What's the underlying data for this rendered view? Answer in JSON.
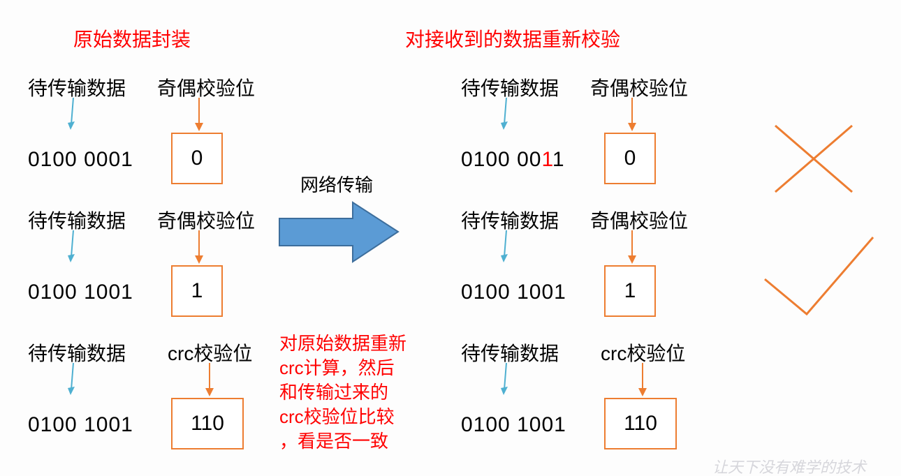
{
  "titles": {
    "left": "原始数据封装",
    "right": "对接收到的数据重新校验"
  },
  "labels": {
    "data_label": "待传输数据",
    "parity_label": "奇偶校验位",
    "crc_label": "crc校验位",
    "transfer": "网络传输"
  },
  "sender": {
    "row1": {
      "data": "0100 0001",
      "parity": "0"
    },
    "row2": {
      "data": "0100 1001",
      "parity": "1"
    },
    "row3": {
      "data": "0100 1001",
      "crc": "110"
    }
  },
  "receiver": {
    "row1": {
      "data_prefix": "0100 00",
      "flipped_bit": "1",
      "data_suffix": "1",
      "parity": "0"
    },
    "row2": {
      "data": "0100 1001",
      "parity": "1"
    },
    "row3": {
      "data": "0100 1001",
      "crc": "110"
    }
  },
  "note": {
    "line1": "对原始数据重新",
    "line2": "crc计算，然后",
    "line3": "和传输过来的",
    "line4": "crc校验位比较",
    "line5": "，看是否一致"
  },
  "watermark": "让天下没有难学的技术",
  "colors": {
    "title_red": "#ff0000",
    "orange": "#ed7d31",
    "blue": "#5b9bd5",
    "arrow_cyan": "#4fb0d1"
  }
}
